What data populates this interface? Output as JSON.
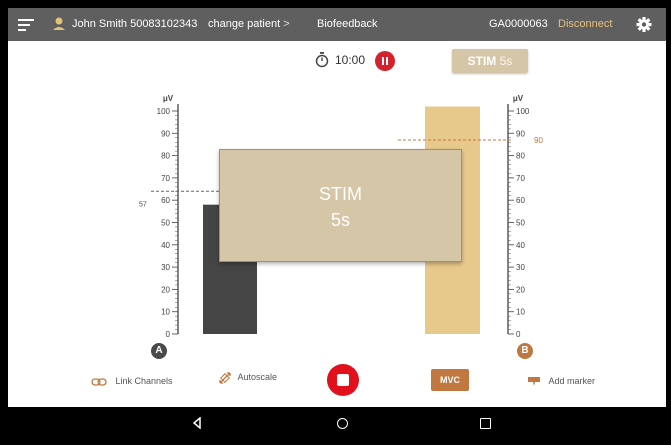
{
  "header": {
    "patient_name": "John Smith 50083102343",
    "change_patient": "change patient",
    "change_patient_chevron": ">",
    "feature_title": "Biofeedback",
    "device_id": "GA0000063",
    "disconnect": "Disconnect"
  },
  "session": {
    "timer": "10:00",
    "stim_button_bold": "STIM",
    "stim_button_light": "5s"
  },
  "overlay": {
    "line1": "STIM",
    "line2": "5s"
  },
  "channels": {
    "unit": "μV",
    "ticks": [
      "0",
      "10",
      "20",
      "30",
      "40",
      "50",
      "60",
      "70",
      "80",
      "90",
      "100"
    ],
    "a": {
      "badge": "A",
      "level_uv": 58,
      "threshold_uv": 64,
      "threshold_label": "57",
      "color": "#454545"
    },
    "b": {
      "badge": "B",
      "level_uv": 102,
      "threshold_uv": 87,
      "threshold_label": "90",
      "color": "#e8c98c"
    }
  },
  "toolbar": {
    "link_channels": "Link Channels",
    "autoscale": "Autoscale",
    "mvc": "MVC",
    "add_marker": "Add marker"
  },
  "colors": {
    "topbar": "#5f5f5f",
    "accent_orange": "#c07840",
    "stop_red": "#e0111c",
    "disconnect": "#e5c17a"
  }
}
